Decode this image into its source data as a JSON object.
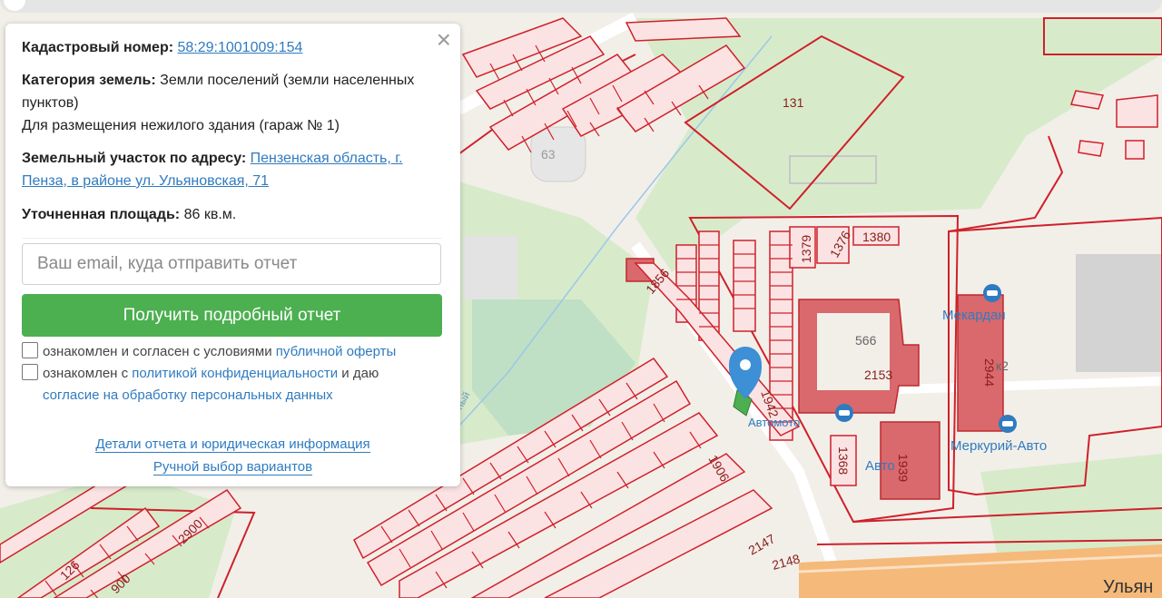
{
  "info": {
    "cadastral_label": "Кадастровый номер:",
    "cadastral_value": "58:29:1001009:154",
    "category_label": "Категория земель:",
    "category_value": "Земли поселений (земли населенных пунктов)",
    "usage": "Для размещения нежилого здания (гараж № 1)",
    "address_label": "Земельный участок по адресу:",
    "address_value": "Пензенская область, г. Пенза, в районе ул. Ульяновская, 71",
    "area_label": "Уточненная площадь:",
    "area_value": "86 кв.м."
  },
  "form": {
    "email_placeholder": "Ваш email, куда отправить отчет",
    "submit_label": "Получить подробный отчет",
    "consent1_text": "ознакомлен и согласен с условиями ",
    "consent1_link": "публичной оферты",
    "consent2_text": "ознакомлен с ",
    "consent2_link": "политикой конфиденциальности",
    "consent2_tail": " и даю",
    "consent2_link2": "согласие на обработку персональных данных"
  },
  "footer": {
    "details_link": "Детали отчета и юридическая информация",
    "manual_link": "Ручной выбор вариантов"
  },
  "close_icon": "close-icon",
  "map": {
    "parcel_labels": [
      "131",
      "63",
      "1856",
      "1379",
      "1376",
      "1380",
      "566",
      "2153",
      "2944",
      "к2",
      "1942",
      "1368",
      "1939",
      "1906",
      "2147",
      "2148",
      "2900",
      "126",
      "900"
    ],
    "poi_labels": [
      "Меркурий-Авто",
      "Мекардан",
      "Авто",
      "Автомото"
    ],
    "street_label": "Ульян",
    "stream_label": "ный",
    "colors": {
      "parcel_stroke": "#d0202a",
      "parcel_fill": "#f3c9c9",
      "building": "#d9696c",
      "green": "#cfe8c4",
      "pin": "#3d8fd6",
      "poi": "#2f7bc0",
      "road_orange": "#f5b97a"
    }
  }
}
